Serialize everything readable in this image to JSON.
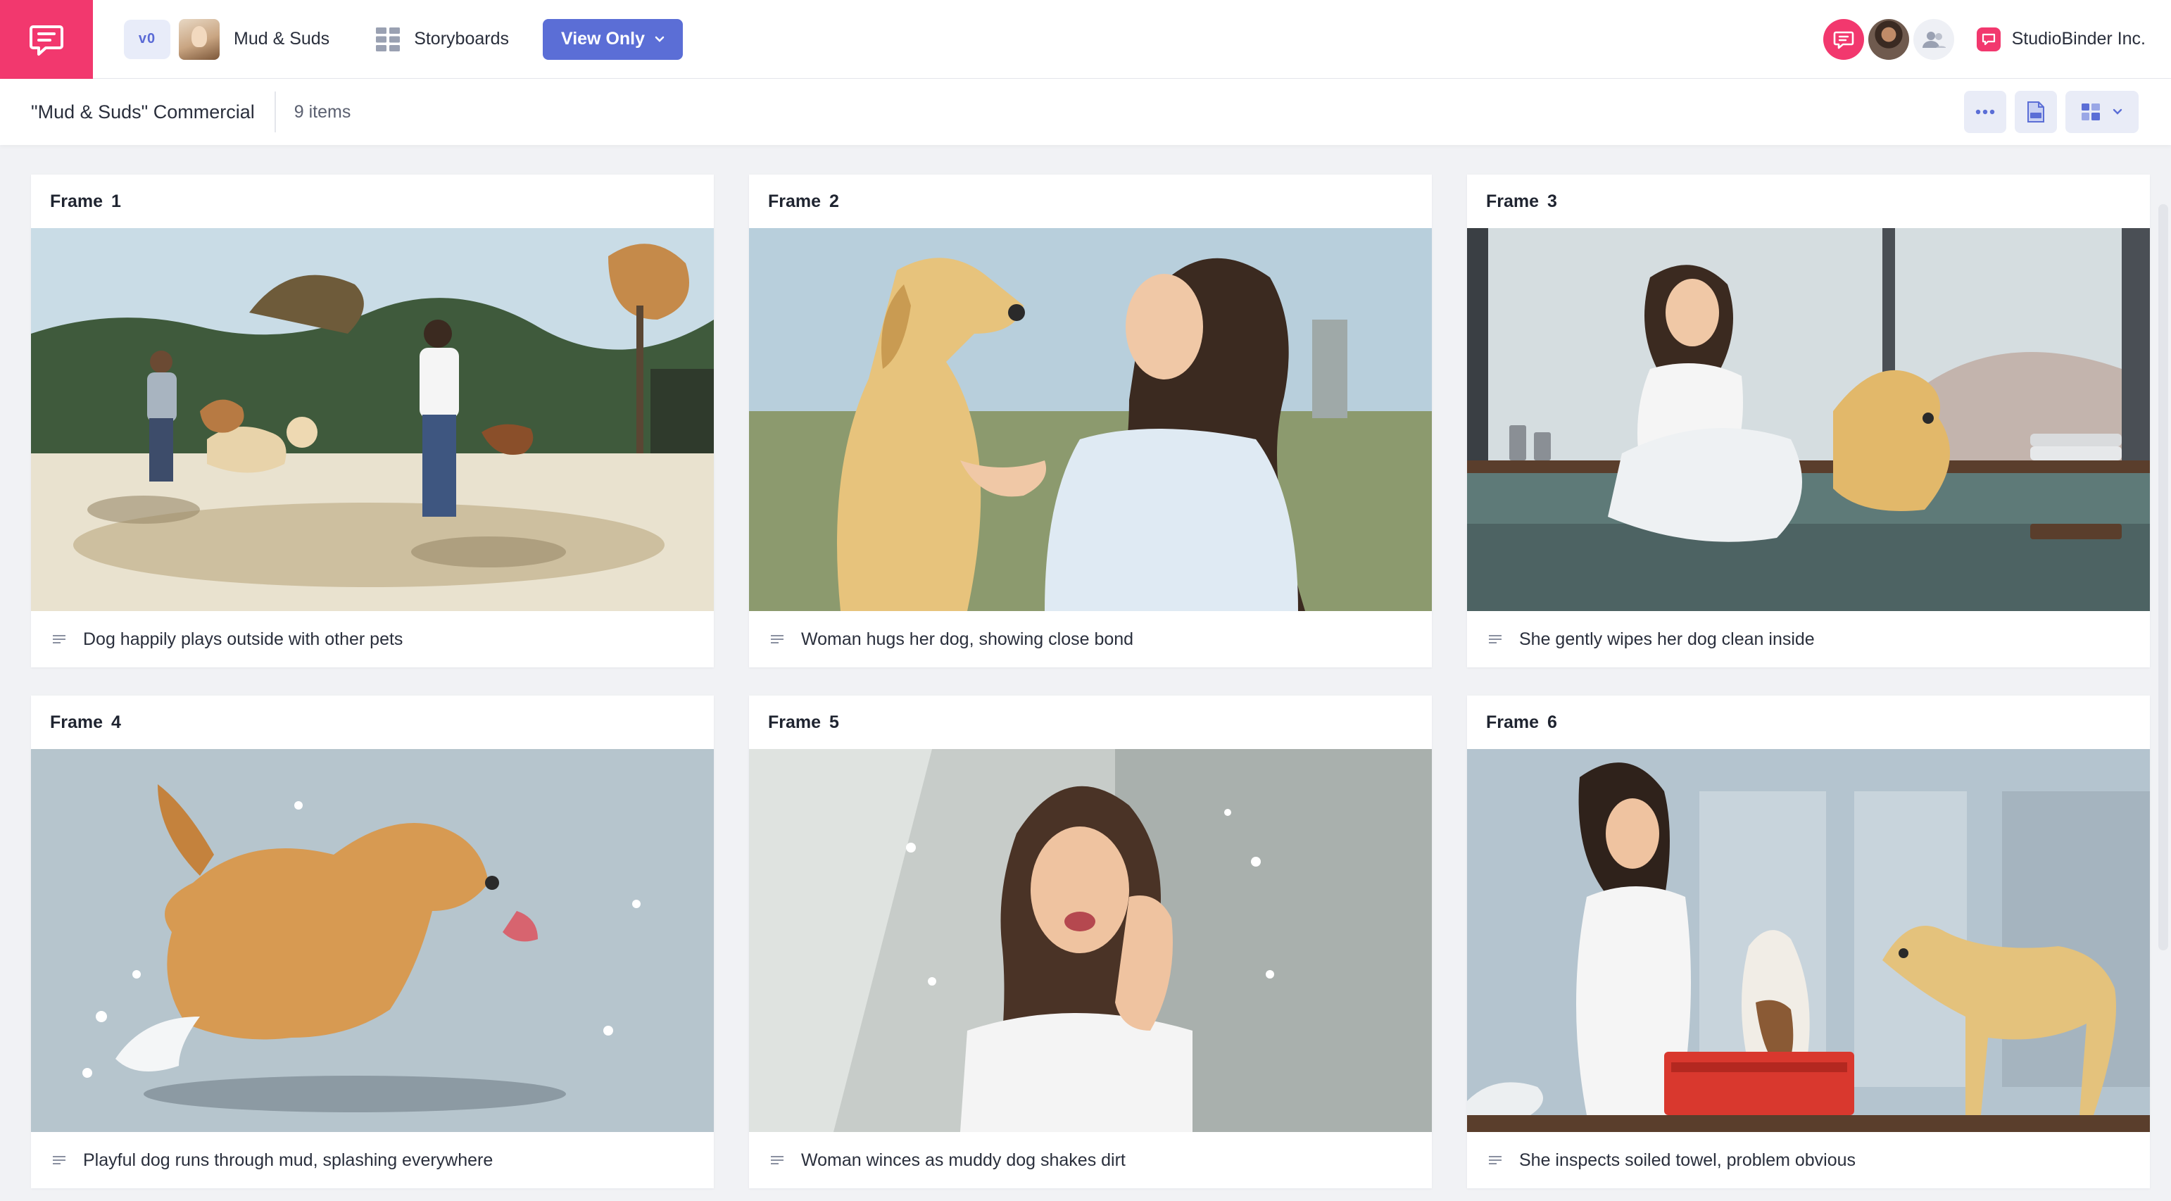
{
  "topbar": {
    "version": "v0",
    "project_name": "Mud & Suds",
    "storyboards_label": "Storyboards",
    "view_button_label": "View Only",
    "org_name": "StudioBinder Inc."
  },
  "subbar": {
    "title": "\"Mud & Suds\" Commercial",
    "item_count": "9 items"
  },
  "frame_label": "Frame",
  "frames": [
    {
      "number": "1",
      "caption": "Dog happily plays outside with other pets"
    },
    {
      "number": "2",
      "caption": "Woman hugs her dog, showing close bond"
    },
    {
      "number": "3",
      "caption": "She gently wipes her dog clean inside"
    },
    {
      "number": "4",
      "caption": "Playful dog runs through mud, splashing everywhere"
    },
    {
      "number": "5",
      "caption": "Woman winces as muddy dog shakes dirt"
    },
    {
      "number": "6",
      "caption": "She inspects soiled towel, problem obvious"
    }
  ],
  "colors": {
    "brand_pink": "#f2386e",
    "accent_blue": "#5b6ed6",
    "background": "#f1f2f5"
  },
  "icons": [
    "chat-bubble-icon",
    "grid-icon",
    "chevron-down-icon",
    "users-icon",
    "more-icon",
    "pdf-icon",
    "layout-icon",
    "notes-icon"
  ]
}
